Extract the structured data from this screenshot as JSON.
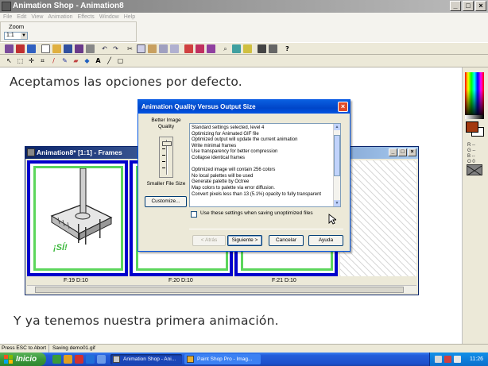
{
  "app": {
    "title": "Animation Shop - Animation8",
    "menu": [
      "File",
      "Edit",
      "View",
      "Animation",
      "Effects",
      "Window",
      "Help"
    ],
    "zoom_label": "Zoom",
    "zoom_value": "1:1",
    "title_buttons": [
      "_",
      "□",
      "×"
    ]
  },
  "canvas": {
    "caption_top": "Aceptamos las opciones por defecto.",
    "caption_bottom": "Y ya tenemos nuestra primera animación."
  },
  "frames_window": {
    "title": "Animation8* [1:1] - Frames",
    "title_buttons": [
      "_",
      "□",
      "×"
    ],
    "thumb_caption": "¡SÍ!",
    "frames": [
      {
        "label": "F:19  D:10"
      },
      {
        "label": "F:20  D:10"
      },
      {
        "label": "F:21  D:10"
      }
    ]
  },
  "dialog": {
    "title": "Animation Quality Versus Output Size",
    "close": "×",
    "quality_top": "Better Image Quality",
    "quality_bottom": "Smaller File Size",
    "customize": "Customize...",
    "info_lines": [
      "Standard settings selected, level 4",
      "Optimizing for Animated GIF file",
      "Optimized output will update the current animation",
      "Write minimal frames",
      "Use transparency for better compression",
      "Collapse identical frames",
      "",
      "Optimized image will contain 256 colors",
      "No local palettes will be used",
      "Generate palette by Octree",
      "Map colors to palette via error diffusion.",
      "Convert pixels less than 13 (5.1%) opacity to fully transparent"
    ],
    "checkbox_label": "Use these settings when saving unoptimized files",
    "buttons": {
      "back": "< Atrás",
      "next": "Siguiente >",
      "cancel": "Cancelar",
      "help": "Ayuda"
    }
  },
  "statusbar": {
    "left": "Press ESC to Abort",
    "right": "Saving demo01.gif"
  },
  "taskbar": {
    "start": "Inicio",
    "tasks": [
      "Animation Shop - Ani...",
      "Paint Shop Pro - Imag..."
    ],
    "clock": "11:26"
  },
  "colors": {
    "foreground": "#a33a10",
    "background": "#ffffff",
    "frame_border_active": "#0000cc",
    "thumb_border": "#5cd65c",
    "xp_blue": "#245edb"
  }
}
